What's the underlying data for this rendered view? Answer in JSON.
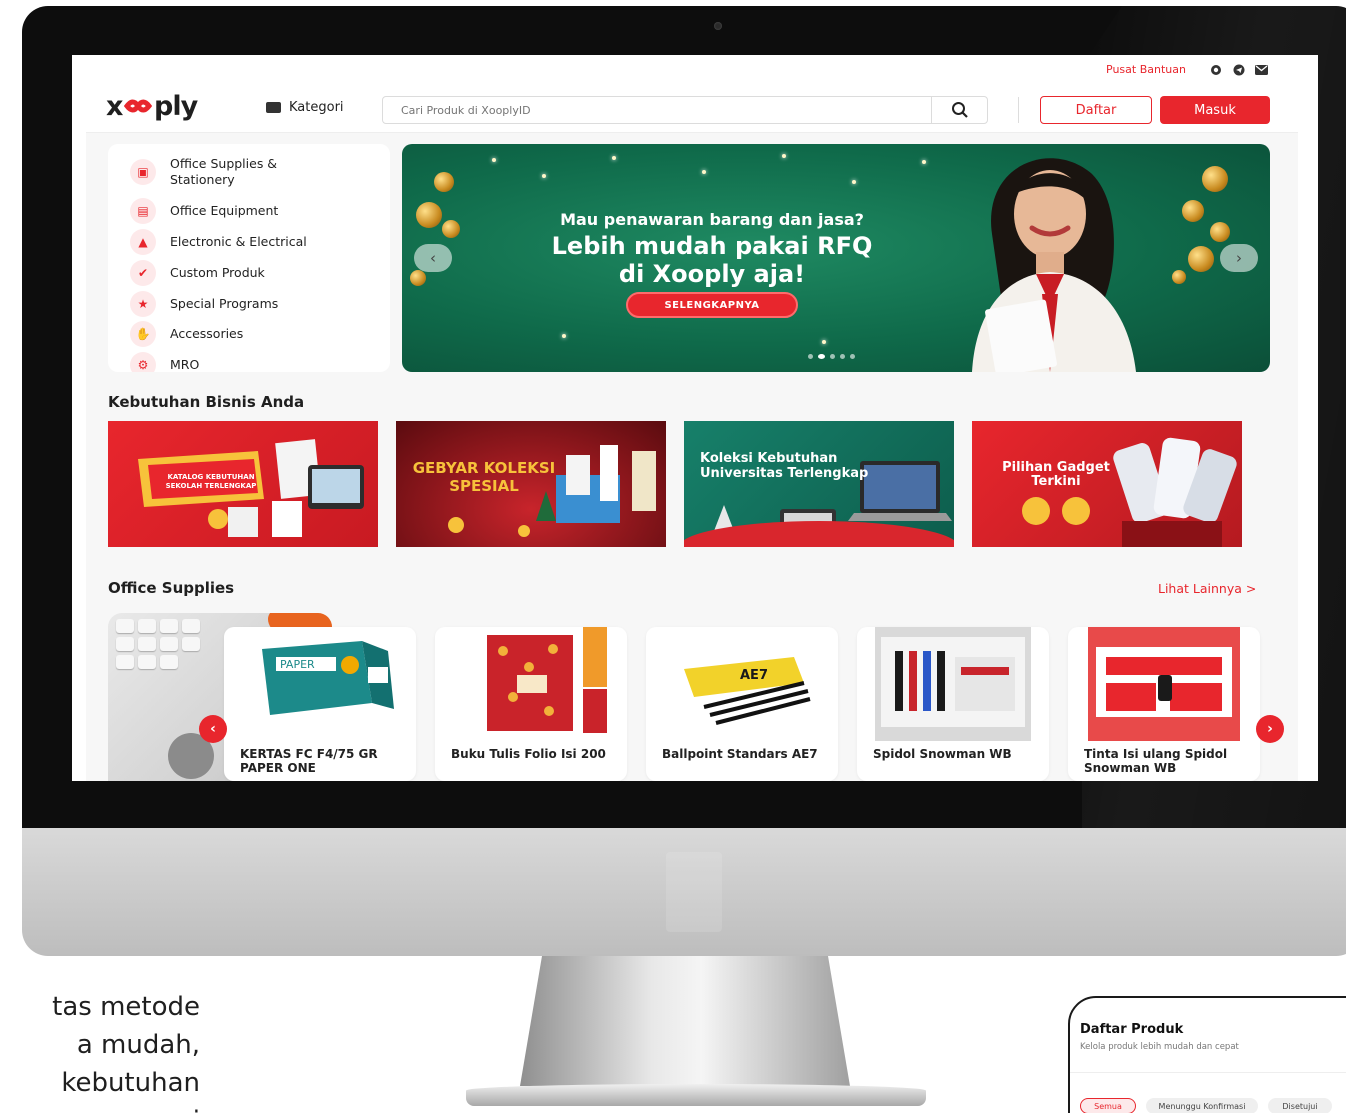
{
  "topbar": {
    "help_link": "Pusat Bantuan",
    "social_icons": [
      "whatsapp-icon",
      "telegram-icon",
      "mail-icon"
    ]
  },
  "header": {
    "logo": "xooply",
    "kategori_label": "Kategori",
    "search_placeholder": "Cari Produk di XooplyID",
    "daftar_label": "Daftar",
    "masuk_label": "Masuk"
  },
  "categories": [
    {
      "label": "Office Supplies & Stationery",
      "icon": "stationery-icon"
    },
    {
      "label": "Office Equipment",
      "icon": "printer-icon"
    },
    {
      "label": "Electronic & Electrical",
      "icon": "warning-icon"
    },
    {
      "label": "Custom Produk",
      "icon": "custom-icon"
    },
    {
      "label": "Special Programs",
      "icon": "star-icon"
    },
    {
      "label": "Accessories",
      "icon": "hand-icon"
    },
    {
      "label": "MRO",
      "icon": "gear-icon"
    }
  ],
  "banner": {
    "subtitle": "Mau penawaran barang dan jasa?",
    "title_line1": "Lebih mudah pakai RFQ",
    "title_line2": "di Xooply aja!",
    "cta": "SELENGKAPNYA",
    "slide_count": 5,
    "active_slide": 2
  },
  "business_section": {
    "title": "Kebutuhan Bisnis Anda",
    "cards": [
      {
        "text": "KATALOG KEBUTUHAN SEKOLAH TERLENGKAP"
      },
      {
        "text": "GEBYAR KOLEKSI SPESIAL"
      },
      {
        "text": "Koleksi Kebutuhan Universitas Terlengkap"
      },
      {
        "text": "Pilihan Gadget Terkini"
      }
    ]
  },
  "office_supplies": {
    "title": "Office Supplies",
    "see_more": "Lihat Lainnya >",
    "products": [
      {
        "name": "KERTAS FC F4/75 GR PAPER ONE"
      },
      {
        "name": "Buku Tulis Folio Isi 200"
      },
      {
        "name": "Ballpoint Standars AE7"
      },
      {
        "name": "Spidol Snowman WB"
      },
      {
        "name": "Tinta Isi ulang Spidol Snowman WB"
      }
    ]
  },
  "side_text": {
    "line1": "tas metode",
    "line2": "a mudah,",
    "line3": "kebutuhan",
    "line4": "i"
  },
  "phone": {
    "title": "Daftar Produk",
    "subtitle": "Kelola produk lebih mudah dan cepat",
    "chips": [
      "Semua",
      "Menunggu Konfirmasi",
      "Disetujui"
    ]
  },
  "colors": {
    "brand": "#e8262d",
    "banner_green": "#0f6a4a"
  }
}
